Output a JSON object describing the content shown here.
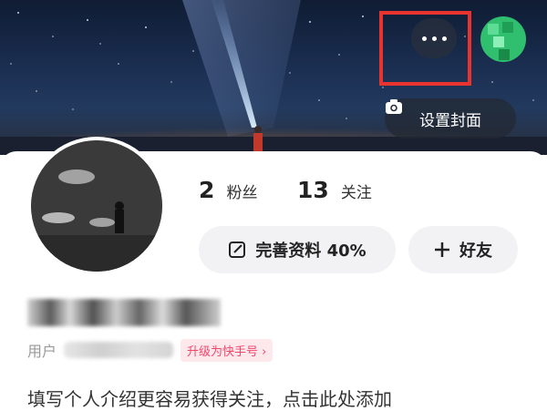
{
  "header": {
    "more_button_label": "•••",
    "set_cover_label": "设置封面",
    "highlight_color": "#e8332e"
  },
  "profile": {
    "fans_count": "2",
    "fans_label": "粉丝",
    "following_count": "13",
    "following_label": "关注",
    "complete_profile_label": "完善资料 40%",
    "add_friend_label": "好友",
    "user_id_label": "用户",
    "upgrade_label": "升级为快手号",
    "bio_placeholder": "填写个人介绍更容易获得关注，点击此处添加"
  },
  "icons": [
    "more-icon",
    "camera-icon",
    "edit-icon",
    "plus-icon",
    "chevron-right-icon"
  ]
}
